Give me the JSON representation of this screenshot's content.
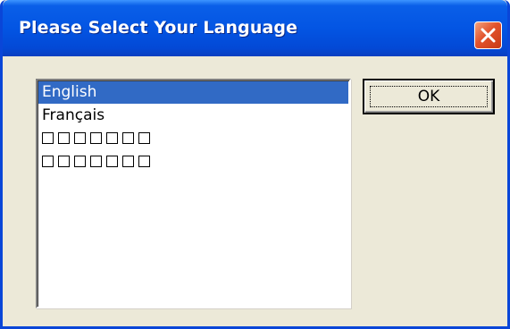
{
  "window": {
    "title": "Please Select Your Language",
    "close_icon": "close-x-icon"
  },
  "language_list": {
    "items": [
      {
        "label": "English",
        "selected": true
      },
      {
        "label": "Français",
        "selected": false
      },
      {
        "label": "",
        "missing_glyphs": 7,
        "selected": false
      },
      {
        "label": "",
        "missing_glyphs": 7,
        "selected": false
      }
    ]
  },
  "buttons": {
    "ok_label": "OK"
  },
  "colors": {
    "titlebar": "#0355e3",
    "selection": "#316ac5",
    "dialog_face": "#ece9d8",
    "close_button": "#e2522c"
  }
}
